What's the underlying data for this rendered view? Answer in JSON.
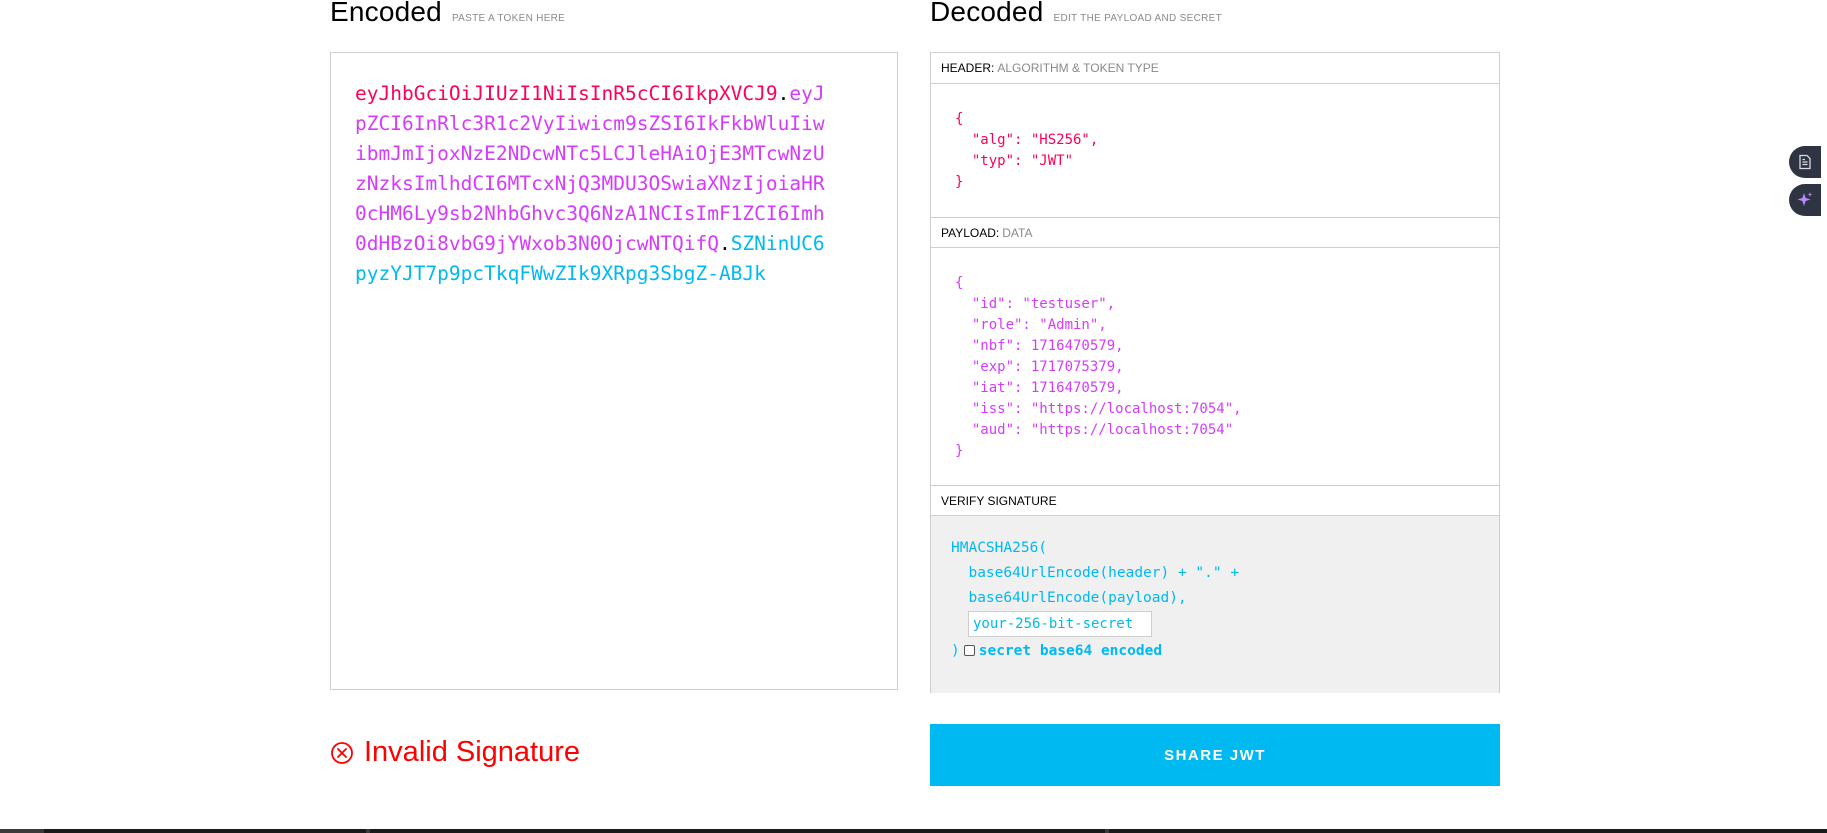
{
  "encoded": {
    "title": "Encoded",
    "hint": "PASTE A TOKEN HERE",
    "token": {
      "header": "eyJhbGciOiJIUzI1NiIsInR5cCI6IkpXVCJ9",
      "payload": "eyJpZCI6InRlc3R1c2VyIiwicm9sZSI6IkFkbWluIiwibmJmIjoxNzE2NDcwNTc5LCJleHAiOjE3MTcwNzUzNzksImlhdCI6MTcxNjQ3MDU3OSwiaXNzIjoiaHR0cHM6Ly9sb2NhbGhvc3Q6NzA1NCIsImF1ZCI6Imh0dHBzOi8vbG9jYWxob3N0OjcwNTQifQ",
      "signature": "SZNinUC6pyzYJT7p9pcTkqFWwZIk9XRpg3SbgZ-ABJk",
      "dot": "."
    }
  },
  "decoded": {
    "title": "Decoded",
    "hint": "EDIT THE PAYLOAD AND SECRET",
    "header_section": {
      "label": "HEADER:",
      "sublabel": "ALGORITHM & TOKEN TYPE"
    },
    "header_json": "{\n  \"alg\": \"HS256\",\n  \"typ\": \"JWT\"\n}",
    "payload_section": {
      "label": "PAYLOAD:",
      "sublabel": "DATA"
    },
    "payload_json": "{\n  \"id\": \"testuser\",\n  \"role\": \"Admin\",\n  \"nbf\": 1716470579,\n  \"exp\": 1717075379,\n  \"iat\": 1716470579,\n  \"iss\": \"https://localhost:7054\",\n  \"aud\": \"https://localhost:7054\"\n}",
    "verify_section": {
      "label": "VERIFY SIGNATURE"
    },
    "verify": {
      "line1": "HMACSHA256(",
      "line2": "  base64UrlEncode(header) + \".\" +",
      "line3": "  base64UrlEncode(payload),",
      "secret_placeholder": "your-256-bit-secret",
      "close_paren": ")",
      "checkbox_label": "secret base64 encoded",
      "checkbox_checked": false
    }
  },
  "status": {
    "text": "Invalid Signature",
    "color": "#ff0000"
  },
  "share_button": {
    "label": "SHARE JWT",
    "color": "#00b9f1"
  },
  "colors": {
    "header": "#fb015b",
    "payload": "#d63aff",
    "signature": "#00b9f1"
  },
  "side_icons": [
    "document-icon",
    "sparkle-icon"
  ]
}
